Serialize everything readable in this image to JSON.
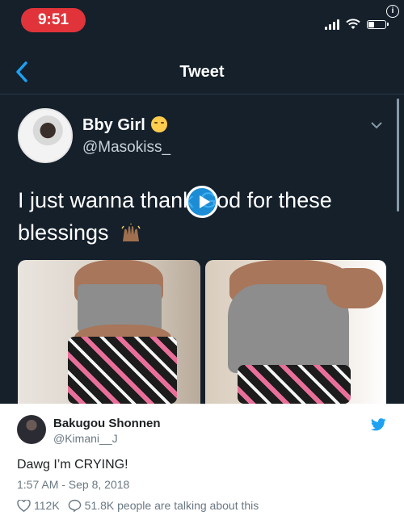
{
  "video": {
    "status_bar": {
      "time": "9:51",
      "battery_level": 0.3
    },
    "nav": {
      "title": "Tweet"
    },
    "tweet": {
      "author_name": "Bby Girl",
      "author_handle": "@Masokiss_",
      "text_line1": "I just wanna thank God for these",
      "text_line2": "blessings"
    },
    "icons": {
      "back": "chevron-left-icon",
      "play": "play-icon",
      "more": "chevron-down-icon",
      "info": "info-icon"
    }
  },
  "card": {
    "author_name": "Bakugou Shonnen",
    "author_handle": "@Kimani__J",
    "text": "Dawg I’m CRYING!",
    "timestamp": "1:57 AM - Sep 8, 2018",
    "likes": "112K",
    "replies_text": "51.8K people are talking about this",
    "accent_color": "#1da1f2"
  }
}
